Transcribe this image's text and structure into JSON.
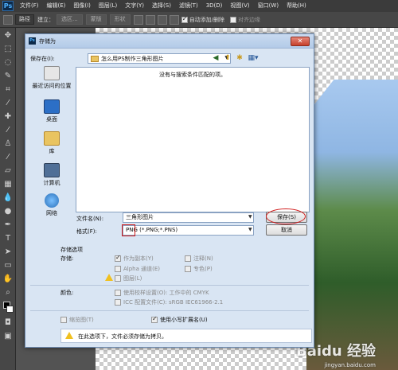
{
  "app": {
    "logo": "Ps",
    "menus": [
      "文件(F)",
      "编辑(E)",
      "图像(I)",
      "图层(L)",
      "文字(Y)",
      "选择(S)",
      "滤镜(T)",
      "3D(D)",
      "视图(V)",
      "窗口(W)",
      "帮助(H)"
    ]
  },
  "options_bar": {
    "path_mode": "路径",
    "build_label": "建立：",
    "selection_btn": "选区...",
    "mask_btn": "蒙版",
    "shape_btn": "形状",
    "auto_add_delete": "自动添加/删除",
    "align_edges": "对齐边缘"
  },
  "dialog": {
    "title": "存储为",
    "save_in_label": "保存在(I):",
    "folder": "怎么用PS制作三角形图片",
    "empty_message": "没有与搜索条件匹配的项。",
    "places": [
      {
        "label": "最近访问的位置",
        "icon": "recent-places-icon"
      },
      {
        "label": "桌面",
        "icon": "desktop-icon"
      },
      {
        "label": "库",
        "icon": "libraries-icon"
      },
      {
        "label": "计算机",
        "icon": "computer-icon"
      },
      {
        "label": "网络",
        "icon": "network-icon"
      }
    ],
    "filename_label": "文件名(N):",
    "filename_value": "三角形图片",
    "format_label": "格式(F):",
    "format_value": "PNG (*.PNG;*.PNS)",
    "save_button": "保存(S)",
    "cancel_button": "取消",
    "save_options_heading": "存储选项",
    "storage_label": "存储:",
    "as_copy": "作为副本(Y)",
    "notes": "注释(N)",
    "alpha_channels": "Alpha 通道(E)",
    "spot_colors": "专色(P)",
    "layers": "图层(L)",
    "color_label": "颜色:",
    "use_proof_setup": "使用校样设置(O): 工作中的 CMYK",
    "icc_profile": "ICC 配置文件(C): sRGB IEC61966-2.1",
    "thumbnail": "缩览图(T)",
    "lowercase_ext": "使用小写扩展名(U)",
    "warning": "在此选项下，文件必须存储为拷贝。"
  },
  "watermark": {
    "brand": "Baidu 经验",
    "url": "jingyan.baidu.com"
  }
}
